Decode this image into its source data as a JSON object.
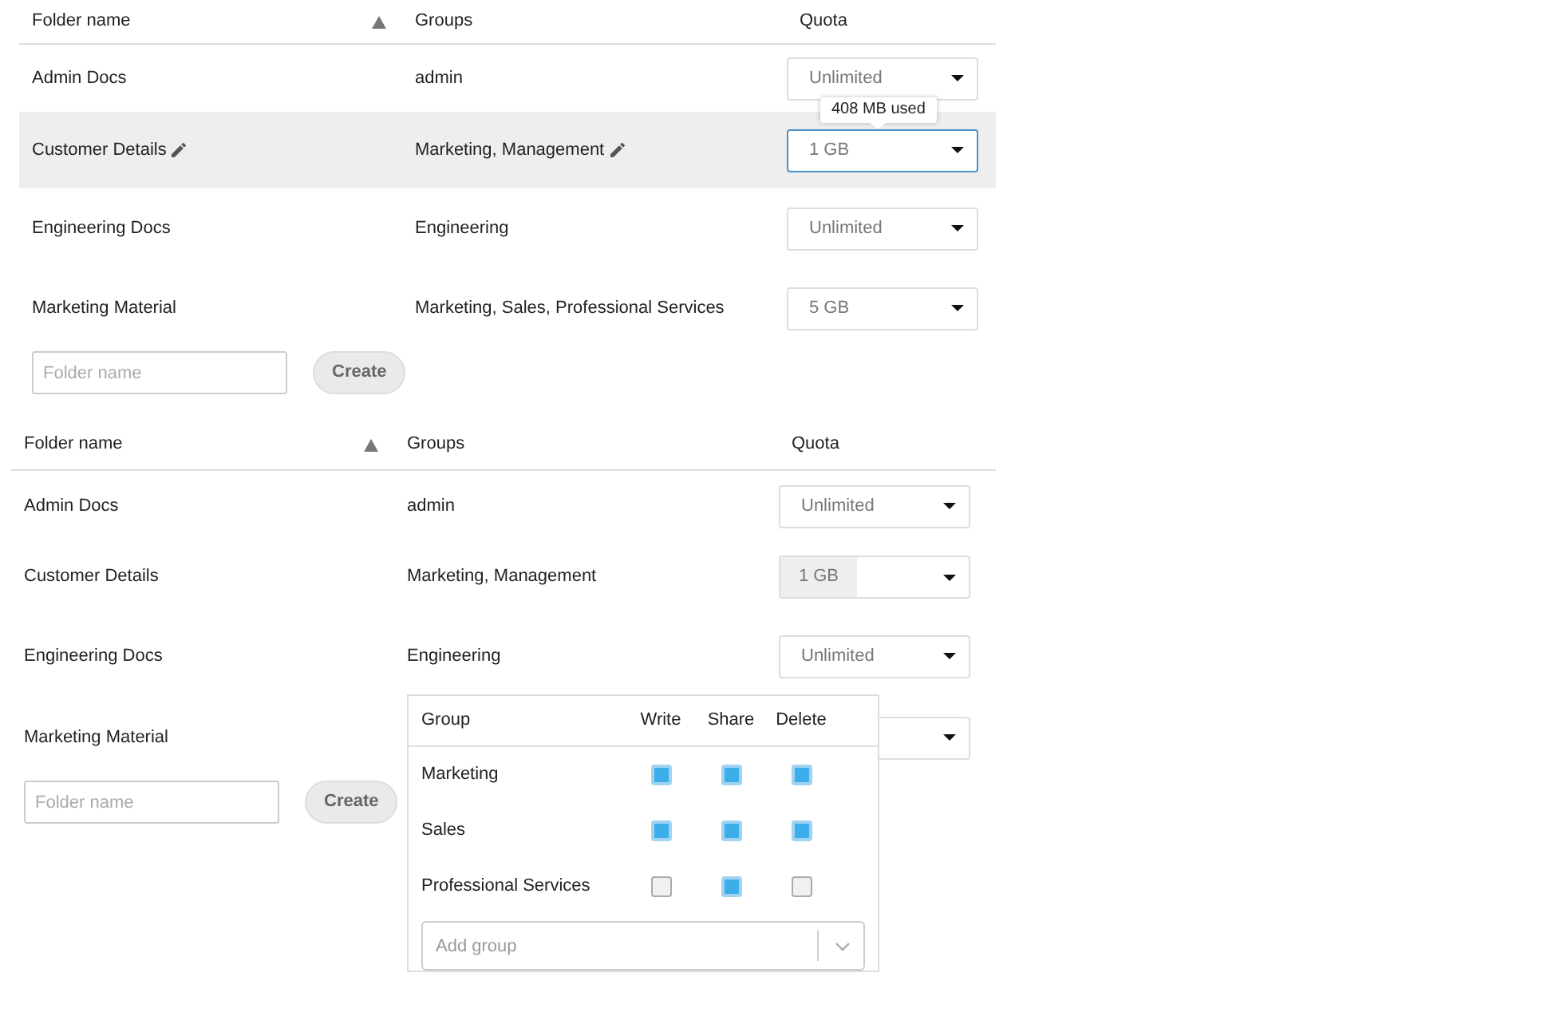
{
  "tables": [
    {
      "columns": [
        "Folder name",
        "Groups",
        "Quota"
      ],
      "rows": [
        {
          "name": "Admin Docs",
          "groups": "admin",
          "selected": false,
          "editable": false,
          "quota": {
            "kind": "select",
            "value": "Unlimited",
            "focused": false
          }
        },
        {
          "name": "Customer Details",
          "groups": "Marketing, Management",
          "selected": true,
          "editable": true,
          "quota": {
            "kind": "select",
            "value": "1 GB",
            "focused": true,
            "tooltip": "408 MB used"
          }
        },
        {
          "name": "Engineering Docs",
          "groups": "Engineering",
          "selected": false,
          "editable": false,
          "quota": {
            "kind": "select",
            "value": "Unlimited",
            "focused": false
          }
        },
        {
          "name": "Marketing Material",
          "groups": "Marketing, Sales, Professional Services",
          "selected": false,
          "editable": false,
          "quota": {
            "kind": "select",
            "value": "5 GB",
            "focused": false
          }
        }
      ],
      "new_folder": {
        "placeholder": "Folder name",
        "button": "Create"
      }
    },
    {
      "columns": [
        "Folder name",
        "Groups",
        "Quota"
      ],
      "rows": [
        {
          "name": "Admin Docs",
          "groups": "admin",
          "selected": false,
          "editable": false,
          "quota": {
            "kind": "select",
            "value": "Unlimited",
            "focused": false
          }
        },
        {
          "name": "Customer Details",
          "groups": "Marketing, Management",
          "selected": false,
          "editable": false,
          "quota": {
            "kind": "readonly",
            "value": "1 GB",
            "focused": false
          }
        },
        {
          "name": "Engineering Docs",
          "groups": "Engineering",
          "selected": false,
          "editable": false,
          "quota": {
            "kind": "select",
            "value": "Unlimited",
            "focused": false
          }
        },
        {
          "name": "Marketing Material",
          "selected": false,
          "editable": false,
          "quota": {
            "kind": "select",
            "focused": false
          }
        }
      ],
      "new_folder": {
        "placeholder": "Folder name",
        "button": "Create"
      },
      "permissions_popup": {
        "columns": [
          "Group",
          "Write",
          "Share",
          "Delete"
        ],
        "rows": [
          {
            "group": "Marketing",
            "write": true,
            "share": true,
            "delete": true
          },
          {
            "group": "Sales",
            "write": true,
            "share": true,
            "delete": true
          },
          {
            "group": "Professional Services",
            "write": false,
            "share": true,
            "delete": false
          }
        ],
        "add_group": {
          "placeholder": "Add group"
        }
      }
    }
  ]
}
